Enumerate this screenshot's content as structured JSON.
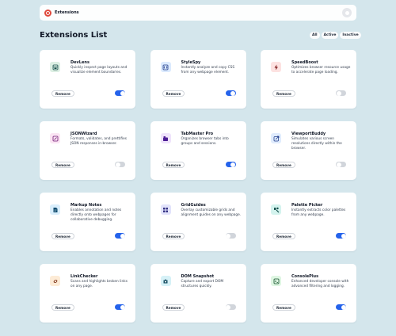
{
  "header": {
    "app_name": "Extensions"
  },
  "list_title": "Extensions List",
  "filters": [
    "All",
    "Active",
    "Inactive"
  ],
  "remove_label": "Remove",
  "extensions": [
    {
      "name": "DevLens",
      "description": "Quickly inspect page layouts and visualize element boundaries.",
      "active": true,
      "icon": "devlens-icon",
      "icon_bg": "#dcefe3",
      "icon_color": "#134e4a"
    },
    {
      "name": "StyleSpy",
      "description": "Instantly analyze and copy CSS from any webpage element.",
      "active": true,
      "icon": "stylespy-icon",
      "icon_bg": "#dbeafe",
      "icon_color": "#1e3a8a"
    },
    {
      "name": "SpeedBoost",
      "description": "Optimizes browser resource usage to accelerate page loading.",
      "active": false,
      "icon": "speedboost-icon",
      "icon_bg": "#fde2e1",
      "icon_color": "#7f1d1d"
    },
    {
      "name": "JSONWizard",
      "description": "Formats, validates, and prettifies JSON responses in-browser.",
      "active": false,
      "icon": "jsonwizard-icon",
      "icon_bg": "#fbe4f3",
      "icon_color": "#701a75"
    },
    {
      "name": "TabMaster Pro",
      "description": "Organizes browser tabs into groups and sessions.",
      "active": true,
      "icon": "tabmaster-icon",
      "icon_bg": "#efe3fb",
      "icon_color": "#4c1d95"
    },
    {
      "name": "ViewportBuddy",
      "description": "Simulates various screen resolutions directly within the browser.",
      "active": false,
      "icon": "viewportbuddy-icon",
      "icon_bg": "#e0ecfd",
      "icon_color": "#1e3a8a"
    },
    {
      "name": "Markup Notes",
      "description": "Enables annotation and notes directly onto webpages for collaborative debugging.",
      "active": true,
      "icon": "markupnotes-icon",
      "icon_bg": "#d9eefc",
      "icon_color": "#0c4a6e"
    },
    {
      "name": "GridGuides",
      "description": "Overlay customizable grids and alignment guides on any webpage.",
      "active": false,
      "icon": "gridguides-icon",
      "icon_bg": "#e2e3fb",
      "icon_color": "#312e81"
    },
    {
      "name": "Palette Picker",
      "description": "Instantly extracts color palettes from any webpage.",
      "active": true,
      "icon": "palettepicker-icon",
      "icon_bg": "#d4f3ee",
      "icon_color": "#134e4a"
    },
    {
      "name": "LinkChecker",
      "description": "Scans and highlights broken links on any page.",
      "active": true,
      "icon": "linkchecker-icon",
      "icon_bg": "#fdebd6",
      "icon_color": "#7c2d12"
    },
    {
      "name": "DOM Snapshot",
      "description": "Capture and export DOM structures quickly.",
      "active": false,
      "icon": "domsnapshot-icon",
      "icon_bg": "#d6f1f7",
      "icon_color": "#164e63"
    },
    {
      "name": "ConsolePlus",
      "description": "Enhanced developer console with advanced filtering and logging.",
      "active": true,
      "icon": "consoleplus-icon",
      "icon_bg": "#def6e2",
      "icon_color": "#14532d"
    }
  ]
}
